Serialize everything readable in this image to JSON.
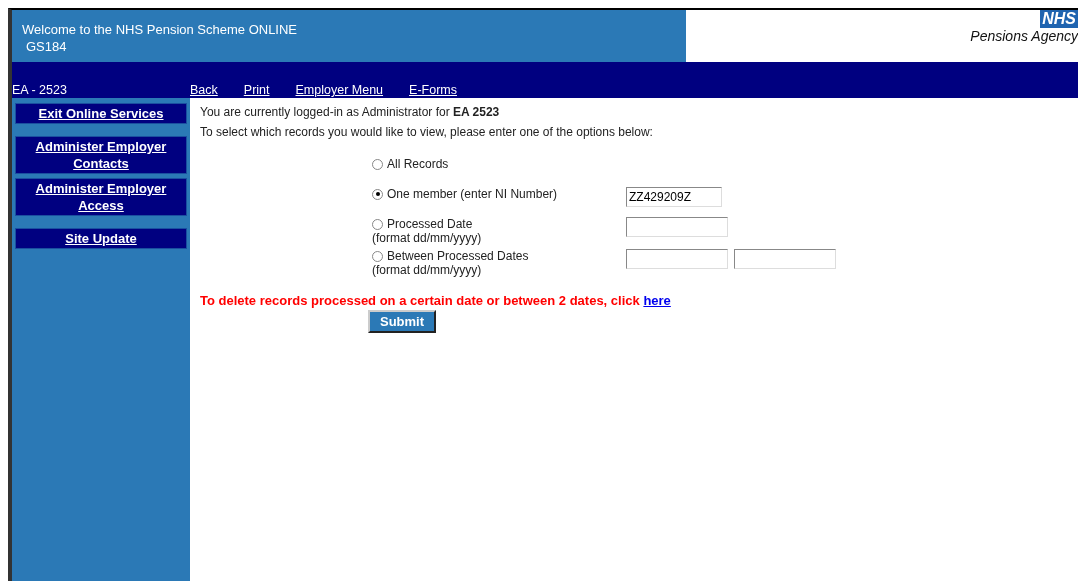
{
  "header": {
    "title": "Welcome to the NHS Pension Scheme ONLINE",
    "code": "GS184",
    "logo_badge": "NHS",
    "logo_text": "Pensions Agency"
  },
  "navbar": {
    "employer": "EA - 2523",
    "links": [
      "Back",
      "Print",
      "Employer Menu",
      "E-Forms"
    ]
  },
  "sidebar": {
    "items": [
      {
        "label": "Exit Online Services"
      },
      {
        "label": "Administer Employer Contacts"
      },
      {
        "label": "Administer Employer Access"
      },
      {
        "label": "Site Update"
      }
    ]
  },
  "main": {
    "login_text": "You are currently logged-in as Administrator for **EA 2523**",
    "instruction": "To select which records you would like to view, please enter one of the options below:",
    "options": [
      {
        "label": "All Records",
        "selected": false
      },
      {
        "label": "One member (enter NI Number)",
        "selected": true,
        "inputs": [
          {
            "kind": "short",
            "value": "ZZ429209Z"
          }
        ]
      },
      {
        "label": "Processed Date",
        "hint": "(format dd/mm/yyyy)",
        "selected": false,
        "inputs": [
          {
            "kind": "long"
          }
        ]
      },
      {
        "label": "Between Processed Dates",
        "hint": "(format dd/mm/yyyy)",
        "selected": false,
        "inputs": [
          {
            "kind": "long"
          },
          {
            "kind": "long"
          }
        ]
      }
    ],
    "delete_text": "To delete records processed on a certain date or between 2 dates, click",
    "delete_link": "here",
    "submit": "Submit"
  }
}
